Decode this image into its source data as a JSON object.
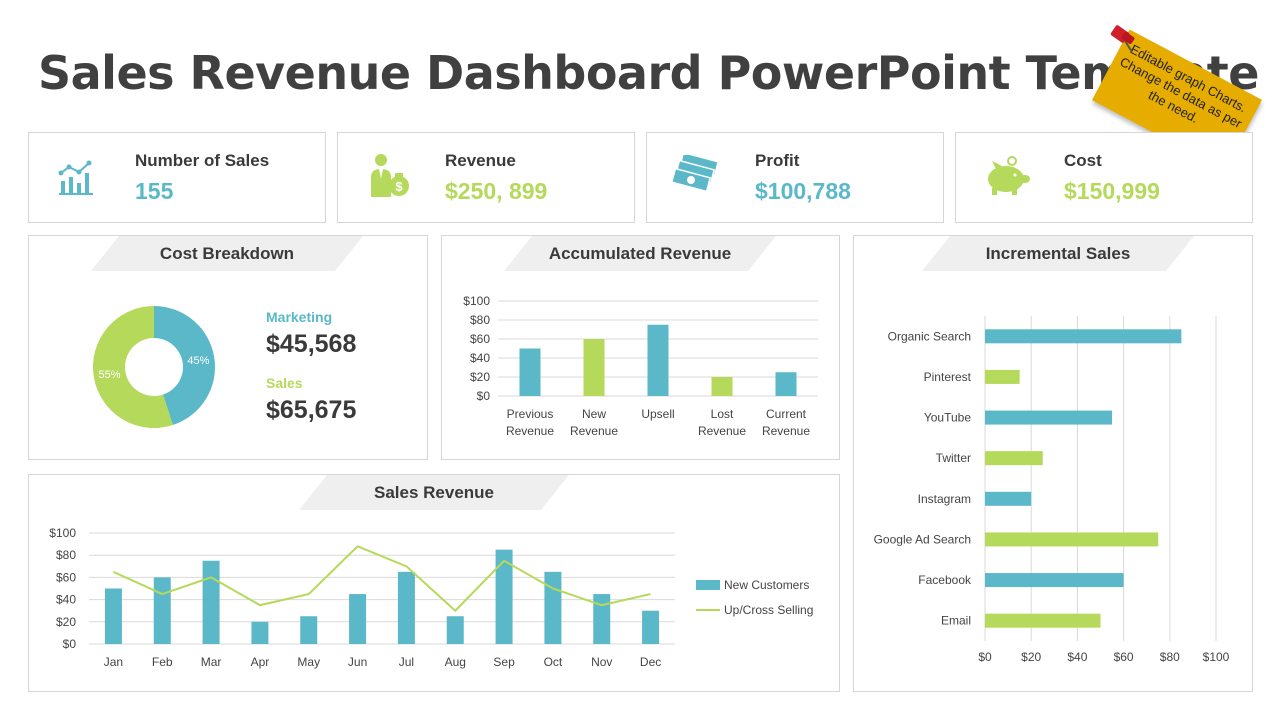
{
  "title": "Sales Revenue Dashboard PowerPoint Template",
  "sticky_note": "Editable graph Charts. Change the data as per the need.",
  "colors": {
    "teal": "#5bb8c8",
    "green": "#b5d95a"
  },
  "kpis": [
    {
      "label": "Number of Sales",
      "value": "155",
      "icon": "chart-icon"
    },
    {
      "label": "Revenue",
      "value": "$250, 899",
      "icon": "businessman-money-icon"
    },
    {
      "label": "Profit",
      "value": "$100,788",
      "icon": "cash-stack-icon"
    },
    {
      "label": "Cost",
      "value": "$150,999",
      "icon": "piggy-bank-icon"
    }
  ],
  "cost_breakdown": {
    "title": "Cost Breakdown",
    "items": [
      {
        "label": "Marketing",
        "value": "$45,568"
      },
      {
        "label": "Sales",
        "value": "$65,675"
      }
    ]
  },
  "accumulated_revenue": {
    "title": "Accumulated Revenue"
  },
  "incremental_sales": {
    "title": "Incremental Sales"
  },
  "sales_revenue": {
    "title": "Sales Revenue"
  },
  "chart_data": [
    {
      "type": "pie",
      "title": "Cost Breakdown",
      "categories": [
        "Marketing",
        "Sales"
      ],
      "values": [
        45,
        55
      ],
      "labels": [
        "45%",
        "55%"
      ]
    },
    {
      "type": "bar",
      "title": "Accumulated Revenue",
      "categories": [
        "Previous Revenue",
        "New Revenue",
        "Upsell",
        "Lost Revenue",
        "Current Revenue"
      ],
      "values": [
        50,
        60,
        75,
        20,
        25
      ],
      "ylim": [
        0,
        100
      ],
      "yticks": [
        "$0",
        "$20",
        "$40",
        "$60",
        "$80",
        "$100"
      ]
    },
    {
      "type": "bar",
      "orientation": "horizontal",
      "title": "Incremental Sales",
      "categories": [
        "Organic Search",
        "Pinterest",
        "YouTube",
        "Twitter",
        "Instagram",
        "Google Ad Search",
        "Facebook",
        "Email"
      ],
      "values": [
        85,
        15,
        55,
        25,
        20,
        75,
        60,
        50
      ],
      "xlim": [
        0,
        100
      ],
      "xticks": [
        "$0",
        "$20",
        "$40",
        "$60",
        "$80",
        "$100"
      ]
    },
    {
      "type": "bar",
      "title": "Sales Revenue",
      "categories": [
        "Jan",
        "Feb",
        "Mar",
        "Apr",
        "May",
        "Jun",
        "Jul",
        "Aug",
        "Sep",
        "Oct",
        "Nov",
        "Dec"
      ],
      "series": [
        {
          "name": "New Customers",
          "type": "bar",
          "values": [
            50,
            60,
            75,
            20,
            25,
            45,
            65,
            25,
            85,
            65,
            45,
            30
          ]
        },
        {
          "name": "Up/Cross Selling",
          "type": "line",
          "values": [
            65,
            45,
            60,
            35,
            45,
            88,
            70,
            30,
            75,
            50,
            35,
            45
          ]
        }
      ],
      "ylim": [
        0,
        100
      ],
      "yticks": [
        "$0",
        "$20",
        "$40",
        "$60",
        "$80",
        "$100"
      ],
      "legend": "right"
    }
  ]
}
